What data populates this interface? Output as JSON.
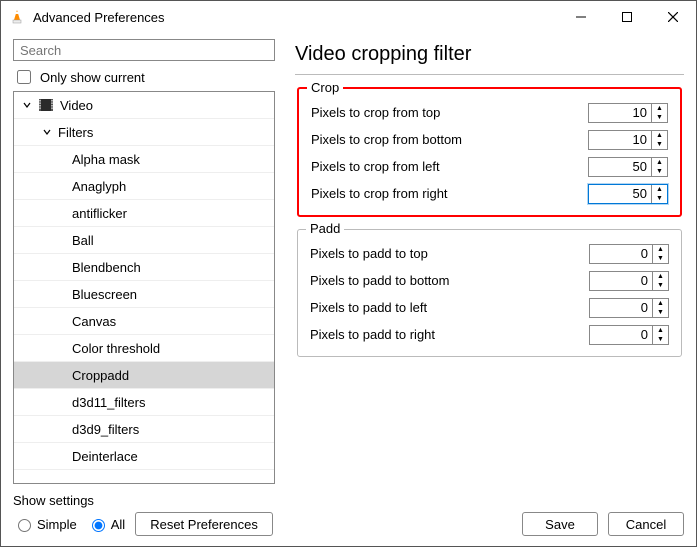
{
  "window": {
    "title": "Advanced Preferences"
  },
  "search": {
    "placeholder": "Search"
  },
  "only_show_current": "Only show current",
  "tree": {
    "video": "Video",
    "filters": "Filters",
    "items": [
      "Alpha mask",
      "Anaglyph",
      "antiflicker",
      "Ball",
      "Blendbench",
      "Bluescreen",
      "Canvas",
      "Color threshold",
      "Croppadd",
      "d3d11_filters",
      "d3d9_filters",
      "Deinterlace"
    ],
    "selected_index": 8
  },
  "page": {
    "title": "Video cropping filter"
  },
  "crop": {
    "legend": "Crop",
    "top": {
      "label": "Pixels to crop from top",
      "value": "10"
    },
    "bottom": {
      "label": "Pixels to crop from bottom",
      "value": "10"
    },
    "left": {
      "label": "Pixels to crop from left",
      "value": "50"
    },
    "right": {
      "label": "Pixels to crop from right",
      "value": "50"
    }
  },
  "padd": {
    "legend": "Padd",
    "top": {
      "label": "Pixels to padd to top",
      "value": "0"
    },
    "bottom": {
      "label": "Pixels to padd to bottom",
      "value": "0"
    },
    "left": {
      "label": "Pixels to padd to left",
      "value": "0"
    },
    "right": {
      "label": "Pixels to padd to right",
      "value": "0"
    }
  },
  "footer": {
    "show_settings": "Show settings",
    "simple": "Simple",
    "all": "All",
    "reset": "Reset Preferences",
    "save": "Save",
    "cancel": "Cancel"
  }
}
